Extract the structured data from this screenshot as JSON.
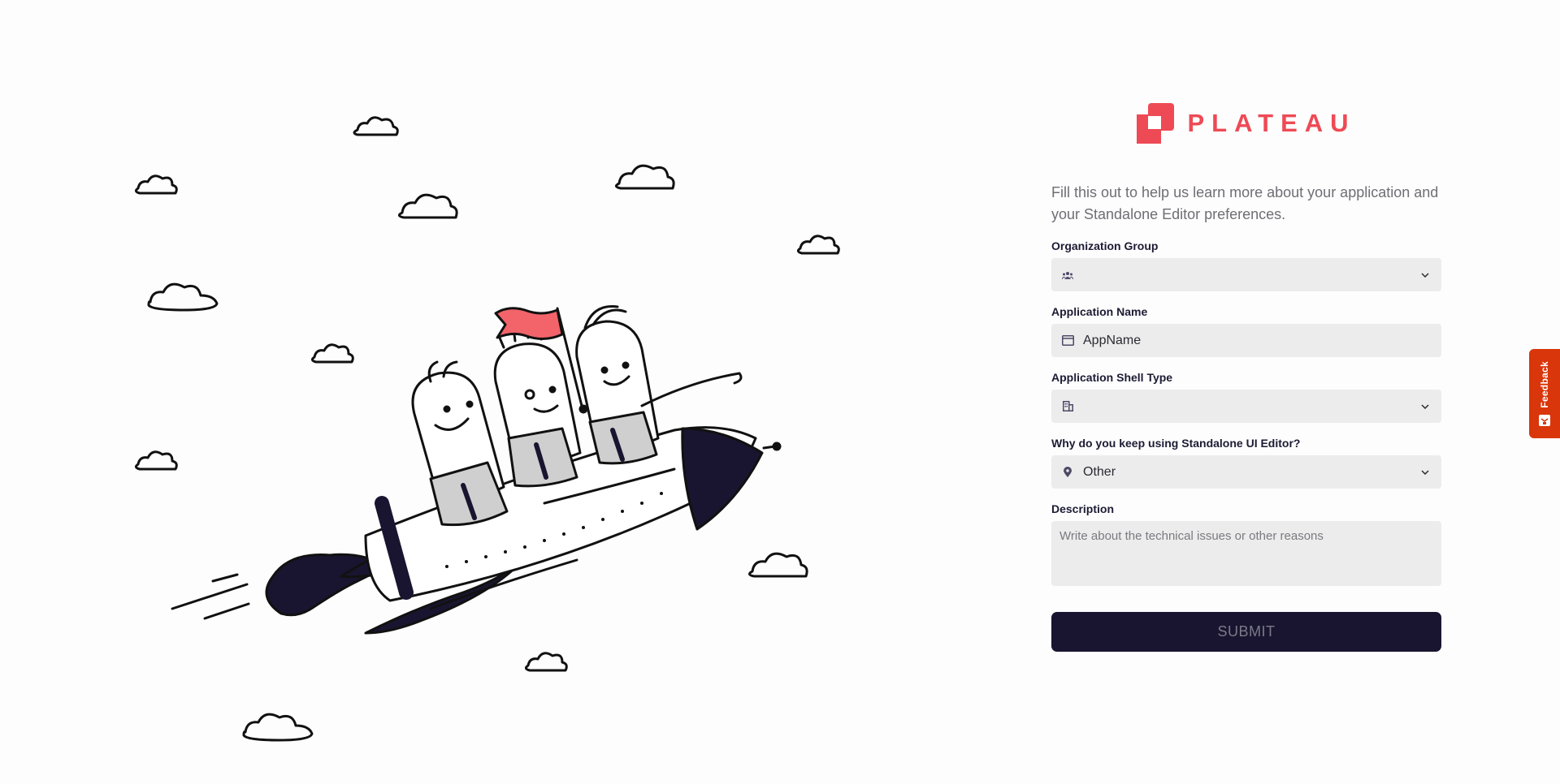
{
  "brand": {
    "name": "PLATEAU",
    "color": "#ee4a55"
  },
  "intro_text": "Fill this out to help us learn more about your application and your Standalone Editor preferences.",
  "form": {
    "organization_group": {
      "label": "Organization Group",
      "value": "",
      "icon": "people-group-icon"
    },
    "application_name": {
      "label": "Application Name",
      "value": "AppName",
      "icon": "window-icon"
    },
    "application_shell_type": {
      "label": "Application Shell Type",
      "value": "",
      "icon": "building-icon"
    },
    "reason": {
      "label": "Why do you keep using Standalone UI Editor?",
      "value": "Other",
      "icon": "map-pin-icon"
    },
    "description": {
      "label": "Description",
      "placeholder": "Write about the technical issues or other reasons",
      "value": ""
    },
    "submit_label": "SUBMIT"
  },
  "feedback": {
    "label": "Feedback",
    "color": "#d9360b"
  },
  "colors": {
    "primary_dark": "#191530",
    "field_bg": "#ececec",
    "flag": "#f2646a"
  }
}
